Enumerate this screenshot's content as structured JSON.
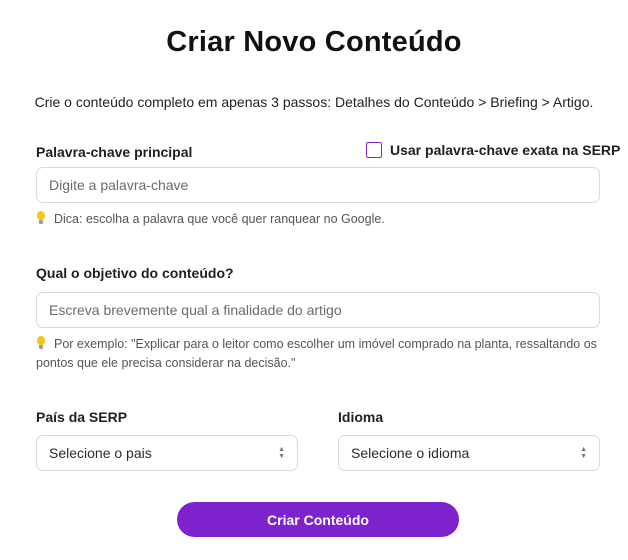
{
  "header": {
    "title": "Criar Novo Conteúdo",
    "subtitle": "Crie o conteúdo completo em apenas 3 passos: Detalhes do Conteúdo > Briefing > Artigo."
  },
  "keyword": {
    "label": "Palavra-chave principal",
    "exact_match_label": "Usar palavra-chave exata na SERP",
    "exact_match_checked": false,
    "value": "",
    "placeholder": "Digite a palavra-chave",
    "hint": "Dica: escolha a palavra que você quer ranquear no Google."
  },
  "objective": {
    "label": "Qual o objetivo do conteúdo?",
    "value": "",
    "placeholder": "Escreva brevemente qual a finalidade do artigo",
    "hint": "Por exemplo: \"Explicar para o leitor como escolher um imóvel comprado na planta, ressaltando os pontos que ele precisa considerar na decisão.\""
  },
  "country": {
    "label": "País da SERP",
    "selected": "Selecione o pais"
  },
  "language": {
    "label": "Idioma",
    "selected": "Selecione o idioma"
  },
  "submit": {
    "label": "Criar Conteúdo"
  },
  "colors": {
    "accent": "#7e22ce",
    "border": "#d9d9de",
    "hint_icon": "#f5c518"
  },
  "icons": {
    "hint": "lightbulb-icon",
    "select": "chevron-up-down-icon"
  }
}
